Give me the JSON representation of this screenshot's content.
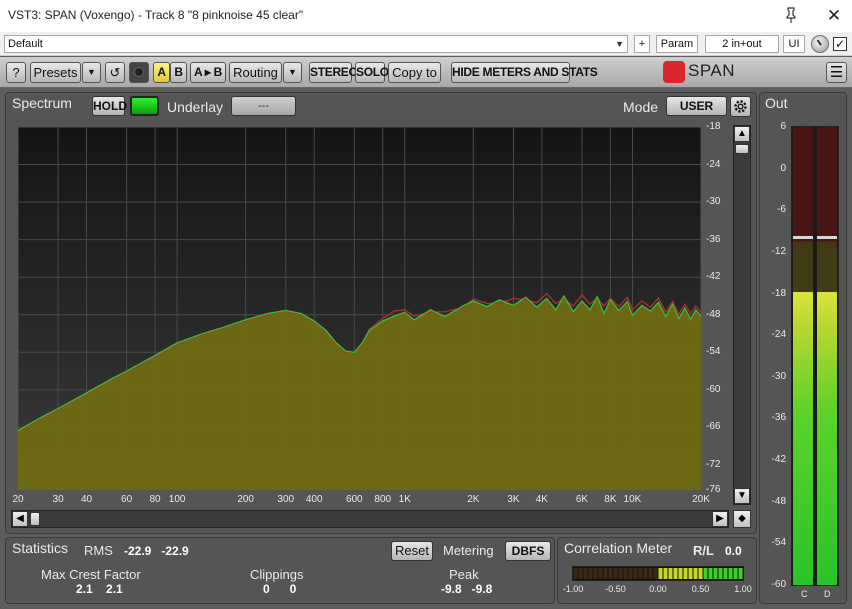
{
  "window": {
    "title": "VST3: SPAN (Voxengo) - Track 8 \"8 pinknoise 45 clear\"",
    "close_symbol": "✕"
  },
  "host_toolbar": {
    "preset": "Default",
    "add_label": "+",
    "param_label": "Param",
    "routing_label": "2 in+out",
    "ui_label": "UI",
    "checkbox_checked": true
  },
  "plugin_toolbar": {
    "help": "?",
    "presets": "Presets",
    "undo_symbol": "↺",
    "a": "A",
    "b": "B",
    "ab_copy": "A ▸ B",
    "routing": "Routing",
    "stereo": "STEREO",
    "solo": "SOLO",
    "copy_to": "Copy to",
    "hide_meters": "HIDE METERS AND STATS",
    "logo": "SPAN",
    "menu_symbol": "☰"
  },
  "spectrum": {
    "title": "Spectrum",
    "hold": "HOLD",
    "underlay_label": "Underlay",
    "underlay_value": "---",
    "mode_label": "Mode",
    "mode_value": "USER"
  },
  "chart_data": {
    "type": "area",
    "x_scale": "log",
    "xlim": [
      20,
      20000
    ],
    "ylim": [
      -76,
      -18
    ],
    "x_ticks": [
      {
        "v": 20,
        "t": "20"
      },
      {
        "v": 30,
        "t": "30"
      },
      {
        "v": 40,
        "t": "40"
      },
      {
        "v": 60,
        "t": "60"
      },
      {
        "v": 80,
        "t": "80"
      },
      {
        "v": 100,
        "t": "100"
      },
      {
        "v": 200,
        "t": "200"
      },
      {
        "v": 300,
        "t": "300"
      },
      {
        "v": 400,
        "t": "400"
      },
      {
        "v": 600,
        "t": "600"
      },
      {
        "v": 800,
        "t": "800"
      },
      {
        "v": 1000,
        "t": "1K"
      },
      {
        "v": 2000,
        "t": "2K"
      },
      {
        "v": 3000,
        "t": "3K"
      },
      {
        "v": 4000,
        "t": "4K"
      },
      {
        "v": 6000,
        "t": "6K"
      },
      {
        "v": 8000,
        "t": "8K"
      },
      {
        "v": 10000,
        "t": "10K"
      },
      {
        "v": 20000,
        "t": "20K"
      }
    ],
    "y_ticks": [
      -18,
      -24,
      -30,
      -36,
      -42,
      -48,
      -54,
      -60,
      -66,
      -72,
      -76
    ],
    "series": [
      {
        "color": "#3dbb3d",
        "fill": "#6f6a12",
        "x": [
          20,
          25,
          30,
          40,
          50,
          60,
          80,
          100,
          130,
          160,
          200,
          250,
          300,
          350,
          400,
          450,
          500,
          550,
          600,
          650,
          700,
          800,
          900,
          1000,
          1100,
          1300,
          1500,
          1800,
          2000,
          2300,
          2600,
          3000,
          3400,
          3800,
          4200,
          4600,
          5000,
          5500,
          6000,
          6500,
          7000,
          7500,
          8000,
          8700,
          9500,
          10000,
          11000,
          12000,
          13000,
          14000,
          15000,
          16000,
          17000,
          18000,
          19000,
          20000
        ],
        "y": [
          -66.5,
          -64.5,
          -63,
          -60.5,
          -58.5,
          -57,
          -54.5,
          -52.5,
          -51,
          -50,
          -48.8,
          -47.8,
          -47.3,
          -47.8,
          -49,
          -50.5,
          -52.5,
          -53.8,
          -54,
          -52.5,
          -50.5,
          -49,
          -48.2,
          -47.6,
          -48.8,
          -47.2,
          -48.3,
          -46.6,
          -45.8,
          -46.7,
          -45.6,
          -46.5,
          -45.2,
          -46.8,
          -45.4,
          -47.2,
          -45,
          -47.5,
          -45.8,
          -47.2,
          -45.1,
          -47.8,
          -45.6,
          -47.3,
          -45.9,
          -48.1,
          -46.5,
          -47.4,
          -46,
          -48.3,
          -46.3,
          -48.6,
          -46.9,
          -48.7,
          -47.2,
          -48.2
        ]
      },
      {
        "color": "#b03030",
        "x": [
          20,
          25,
          30,
          40,
          50,
          60,
          80,
          100,
          130,
          160,
          200,
          250,
          300,
          350,
          400,
          450,
          500,
          550,
          600,
          650,
          700,
          800,
          900,
          1000,
          1100,
          1300,
          1500,
          1800,
          2000,
          2300,
          2600,
          3000,
          3400,
          3800,
          4200,
          4600,
          5000,
          5500,
          6000,
          6500,
          7000,
          7500,
          8000,
          8700,
          9500,
          10000,
          11000,
          12000,
          13000,
          14000,
          15000,
          16000,
          17000,
          18000,
          19000,
          20000
        ],
        "y": [
          -66.6,
          -64.6,
          -63.1,
          -60.6,
          -58.6,
          -57.1,
          -54.6,
          -52.6,
          -51.1,
          -50.1,
          -48.9,
          -47.9,
          -47.4,
          -47.9,
          -49.1,
          -50.6,
          -52.6,
          -53.9,
          -54.1,
          -52.6,
          -50.3,
          -48.6,
          -47.4,
          -47.2,
          -48.2,
          -47.6,
          -47.5,
          -46.9,
          -45.5,
          -46.2,
          -46.2,
          -45.4,
          -45.6,
          -46.1,
          -44.6,
          -46.2,
          -45.4,
          -46.6,
          -44.8,
          -46.3,
          -45.3,
          -46.6,
          -45.4,
          -46.7,
          -45.2,
          -47.2,
          -45.8,
          -46.8,
          -45.3,
          -47.6,
          -45.9,
          -47.9,
          -46.3,
          -47.8,
          -46.6,
          -47.6
        ]
      }
    ]
  },
  "out_meter": {
    "title": "Out",
    "scale": [
      6,
      0,
      -6,
      -12,
      -18,
      -24,
      -30,
      -36,
      -42,
      -48,
      -54,
      -60
    ],
    "channels": [
      {
        "label": "C",
        "level_db": -17.8,
        "peak_db": -9.8
      },
      {
        "label": "D",
        "level_db": -17.8,
        "peak_db": -9.8
      }
    ]
  },
  "statistics": {
    "title": "Statistics",
    "rms_label": "RMS",
    "rms_values": "-22.9   -22.9",
    "reset": "Reset",
    "metering_label": "Metering",
    "metering_value": "DBFS",
    "crest_label": "Max Crest Factor",
    "crest_values": "2.1    2.1",
    "clip_label": "Clippings",
    "clip_values": "0      0",
    "peak_label": "Peak",
    "peak_values": "-9.8   -9.8"
  },
  "correlation": {
    "title": "Correlation Meter",
    "channel_pair": "R/L",
    "value": "0.0",
    "value_num": 0.0,
    "ticks": [
      "-1.00",
      "-0.50",
      "0.00",
      "0.50",
      "1.00"
    ]
  }
}
